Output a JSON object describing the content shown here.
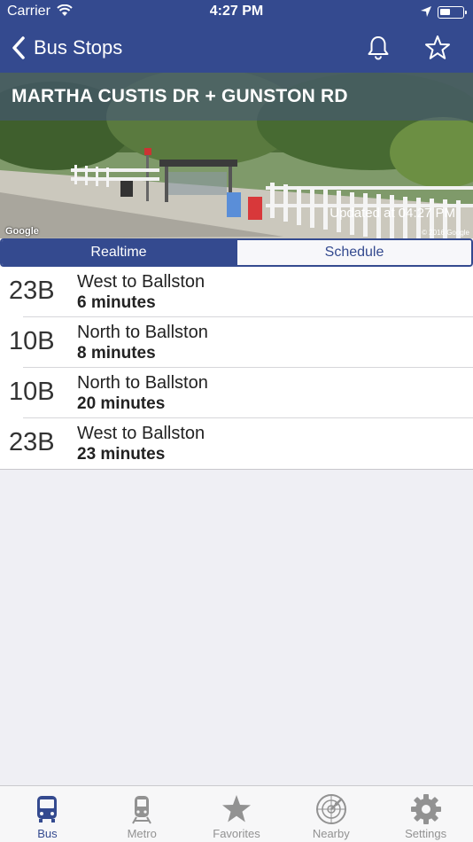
{
  "status_bar": {
    "carrier": "Carrier",
    "time": "4:27 PM"
  },
  "nav": {
    "back_label": "Bus Stops",
    "icons": [
      "chevron-left-icon",
      "bell-icon",
      "star-outline-icon"
    ]
  },
  "stop": {
    "title": "MARTHA CUSTIS DR + GUNSTON RD",
    "updated": "Updated at 04:27 PM",
    "google_logo": "Google",
    "copyright": "© 2016 Google"
  },
  "segments": {
    "realtime": "Realtime",
    "schedule": "Schedule",
    "selected": "Realtime"
  },
  "arrivals": [
    {
      "route": "23B",
      "direction": "West to Ballston",
      "eta": "6 minutes"
    },
    {
      "route": "10B",
      "direction": "North to Ballston",
      "eta": "8 minutes"
    },
    {
      "route": "10B",
      "direction": "North to Ballston",
      "eta": "20 minutes"
    },
    {
      "route": "23B",
      "direction": "West to Ballston",
      "eta": "23 minutes"
    }
  ],
  "tabs": [
    {
      "label": "Bus",
      "icon": "bus-icon",
      "active": true
    },
    {
      "label": "Metro",
      "icon": "train-icon",
      "active": false
    },
    {
      "label": "Favorites",
      "icon": "star-icon",
      "active": false
    },
    {
      "label": "Nearby",
      "icon": "radar-icon",
      "active": false
    },
    {
      "label": "Settings",
      "icon": "gear-icon",
      "active": false
    }
  ],
  "colors": {
    "brand": "#344a8f",
    "background": "#efeff4",
    "tab_inactive": "#929292"
  }
}
